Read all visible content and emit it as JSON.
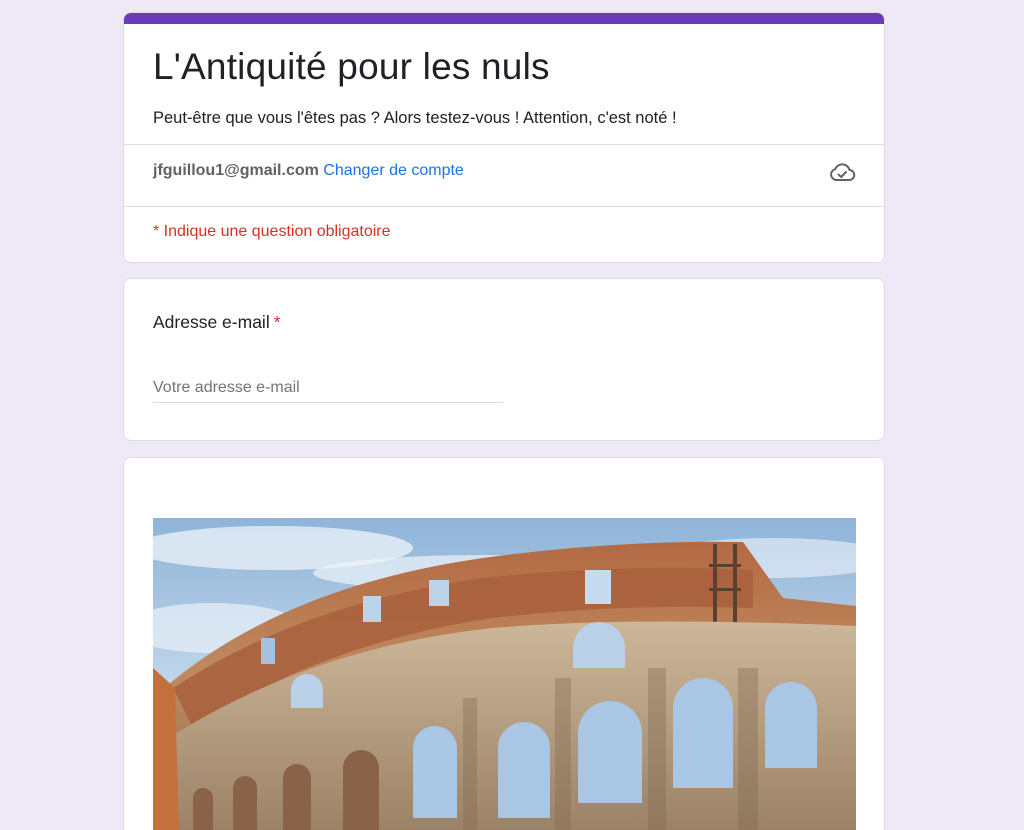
{
  "form": {
    "title": "L'Antiquité pour les nuls",
    "description": "Peut-être que vous l'êtes pas ? Alors testez-vous ! Attention, c'est noté !",
    "account_email": "jfguillou1@gmail.com",
    "switch_account_label": "Changer de compte",
    "required_note": "* Indique une question obligatoire",
    "theme_color": "#673ab7",
    "background_color": "#efe9f7",
    "link_color": "#1a73e8",
    "required_color": "#d93025"
  },
  "icons": {
    "save_status": "cloud-check-icon"
  },
  "email_question": {
    "label": "Adresse e-mail",
    "required_mark": "*",
    "placeholder": "Votre adresse e-mail"
  },
  "image_question": {
    "image": "colosseum-photo"
  }
}
